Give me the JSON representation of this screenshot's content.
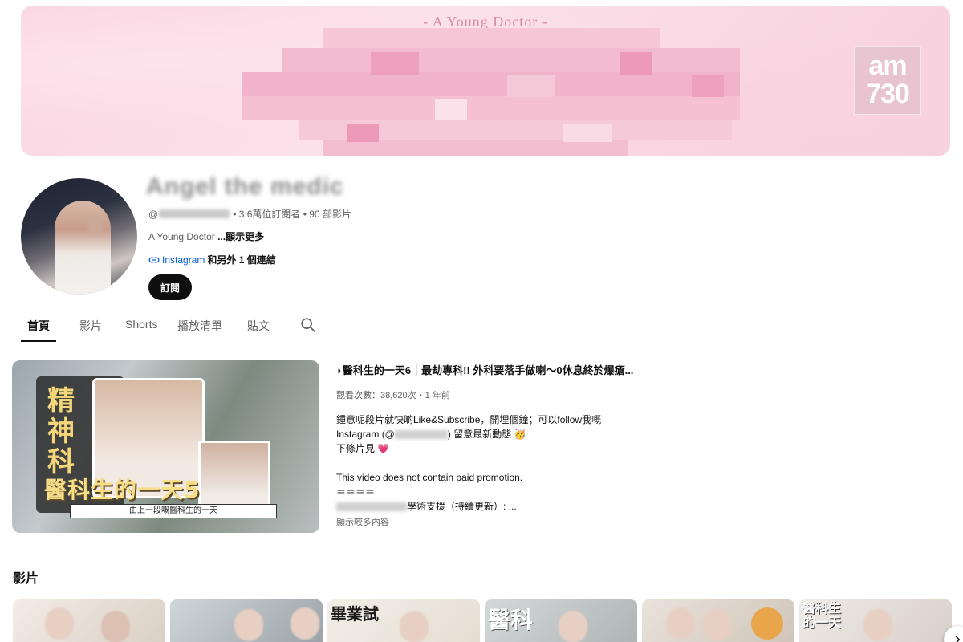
{
  "banner": {
    "title": "- A Young Doctor -",
    "logo_line1": "am",
    "logo_line2": "730"
  },
  "channel": {
    "name": "Angel the medic",
    "handle_prefix": "@",
    "stats": "• 3.6萬位訂閱者 • 90 部影片",
    "description": "A Young Doctor ",
    "description_more": "...顯示更多",
    "link_label": "Instagram",
    "link_rest": " 和另外 1 個連結",
    "subscribe_label": "訂閱"
  },
  "tabs": [
    {
      "label": "首頁",
      "active": true
    },
    {
      "label": "影片",
      "active": false
    },
    {
      "label": "Shorts",
      "active": false
    },
    {
      "label": "播放清單",
      "active": false
    },
    {
      "label": "貼文",
      "active": false
    }
  ],
  "featured": {
    "thumb_vertical_text": "精神科",
    "thumb_title": "醫科生的一天5",
    "thumb_subtitle": "由上一段嘅醫科生的一天",
    "title": "◗醫科生的一天6｜最劫專科!! 外科要落手做喇〜0休息終於爆瘡...",
    "views": "觀看次數：38,620次・1 年前",
    "desc_line1": "鍾意呢段片就快啲Like&Subscribe，開埋個鐘；可以follow我嘅",
    "desc_line2_a": "Instagram (@",
    "desc_line2_b": ") 留意最新動態 🥳",
    "desc_line3": "下條片見 💗",
    "desc_line5": "This video does not contain paid promotion.",
    "desc_line6": "＝＝＝＝",
    "desc_line7": "學術支援（持續更新）: ...",
    "show_more": "顯示較多內容"
  },
  "videos_section": {
    "title": "影片",
    "thumbs": [
      {
        "text": ""
      },
      {
        "text": ""
      },
      {
        "text": "畢業試"
      },
      {
        "text": "醫科"
      },
      {
        "text": ""
      },
      {
        "text": "醫科生的一天"
      }
    ]
  },
  "colors": {
    "link_blue": "#065fd4",
    "banner_pink": "#f9d6e2",
    "text_primary": "#0f0f0f",
    "text_secondary": "#606060"
  }
}
